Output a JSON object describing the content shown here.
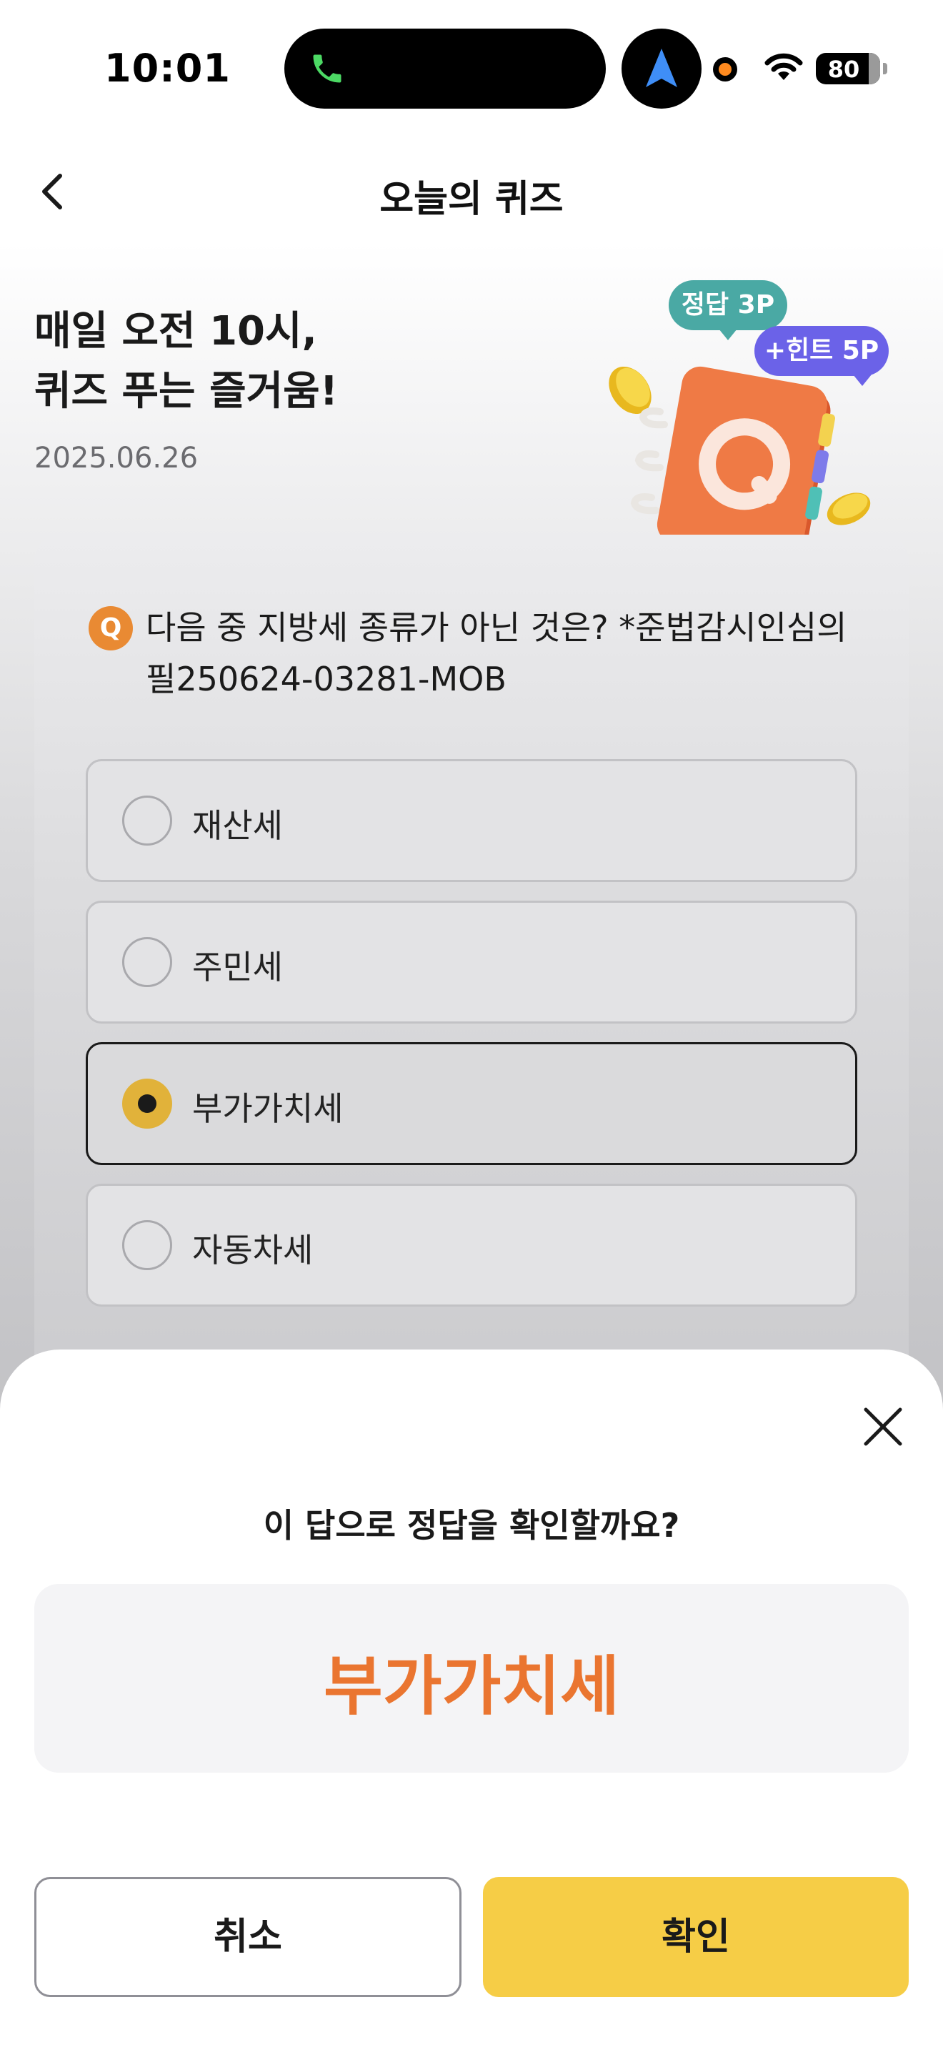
{
  "status_bar": {
    "time": "10:01",
    "battery": "80",
    "battery_level": 0.8
  },
  "header": {
    "title": "오늘의 퀴즈"
  },
  "hero": {
    "title_line1": "매일 오전 10시,",
    "title_line2": "퀴즈 푸는 즐거움!",
    "date": "2025.06.26",
    "badge_answer": "정답 3P",
    "badge_hint": "+힌트 5P"
  },
  "quiz": {
    "q_icon": "Q",
    "question": "다음 중 지방세 종류가 아닌 것은? *준법감시인심의필250624-03281-MOB",
    "options": [
      {
        "label": "재산세",
        "selected": false
      },
      {
        "label": "주민세",
        "selected": false
      },
      {
        "label": "부가가치세",
        "selected": true
      },
      {
        "label": "자동차세",
        "selected": false
      }
    ]
  },
  "sheet": {
    "question": "이 답으로 정답을 확인할까요?",
    "answer": "부가가치세",
    "cancel_label": "취소",
    "confirm_label": "확인"
  },
  "colors": {
    "accent_yellow": "#f6cd46",
    "answer_orange": "#ea7530",
    "badge_teal": "#4aa9a4",
    "badge_purple": "#6b62e8",
    "q_icon_orange": "#e98a33"
  },
  "icons": [
    "phone-icon",
    "navigation-arrow-icon",
    "wifi-icon",
    "battery-icon",
    "back-chevron-icon",
    "quiz-book-icon",
    "coin-icon",
    "close-icon"
  ]
}
